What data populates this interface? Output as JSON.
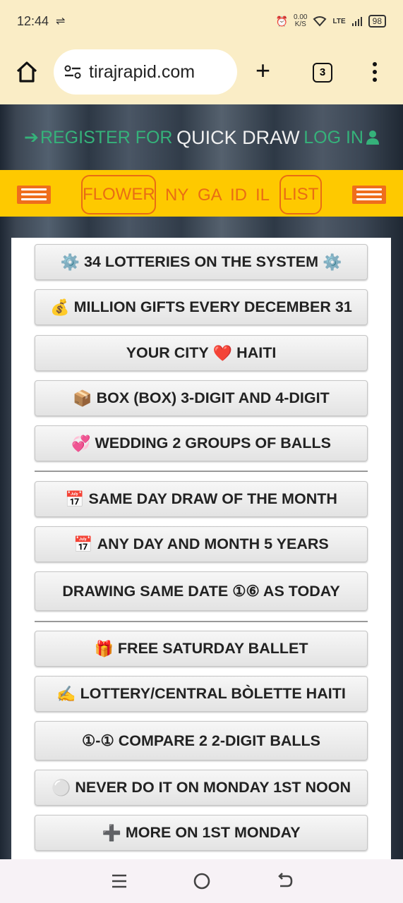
{
  "status": {
    "time": "12:44",
    "netspeed_value": "0.00",
    "netspeed_unit": "K/S",
    "signal_label": "LTE",
    "battery": "98"
  },
  "browser": {
    "url": "tirajrapid.com",
    "tab_count": "3"
  },
  "header": {
    "register": "REGISTER FOR",
    "title": "QUICK DRAW",
    "login": "LOG IN"
  },
  "nav": {
    "flower": "FLOWER",
    "ny": "NY",
    "ga": "GA",
    "id": "ID",
    "il": "IL",
    "list": "LIST"
  },
  "buttons": [
    {
      "icon": "⚙️",
      "label": "34 LOTTERIES ON THE SYSTEM",
      "icon_after": "⚙️"
    },
    {
      "icon": "💰",
      "label": "MILLION GIFTS EVERY DECEMBER 31"
    },
    {
      "label": "YOUR CITY",
      "icon_mid": "❤️",
      "label2": "HAITI"
    },
    {
      "icon": "📦",
      "label": "BOX (BOX) 3-DIGIT AND 4-DIGIT"
    },
    {
      "icon": "💞",
      "label": "WEDDING 2 GROUPS OF BALLS"
    },
    {
      "icon": "📅",
      "label": "SAME DAY DRAW OF THE MONTH"
    },
    {
      "icon": "📅",
      "label": "ANY DAY AND MONTH 5 YEARS"
    },
    {
      "label": "DRAWING SAME DATE ①⑥ AS TODAY"
    },
    {
      "icon": "🎁",
      "label": "FREE SATURDAY BALLET"
    },
    {
      "icon": "✍️",
      "label": "LOTTERY/CENTRAL BÒLETTE HAITI"
    },
    {
      "label": "①-① COMPARE 2 2-DIGIT BALLS"
    },
    {
      "icon": "⚪",
      "label": "NEVER DO IT ON MONDAY 1ST NOON"
    },
    {
      "icon": "➕",
      "label": "MORE ON 1ST MONDAY"
    }
  ],
  "colors": {
    "accent_yellow": "#fec900",
    "accent_orange": "#e96d14",
    "green": "#35b27a",
    "chrome_bar": "#faedc6"
  }
}
